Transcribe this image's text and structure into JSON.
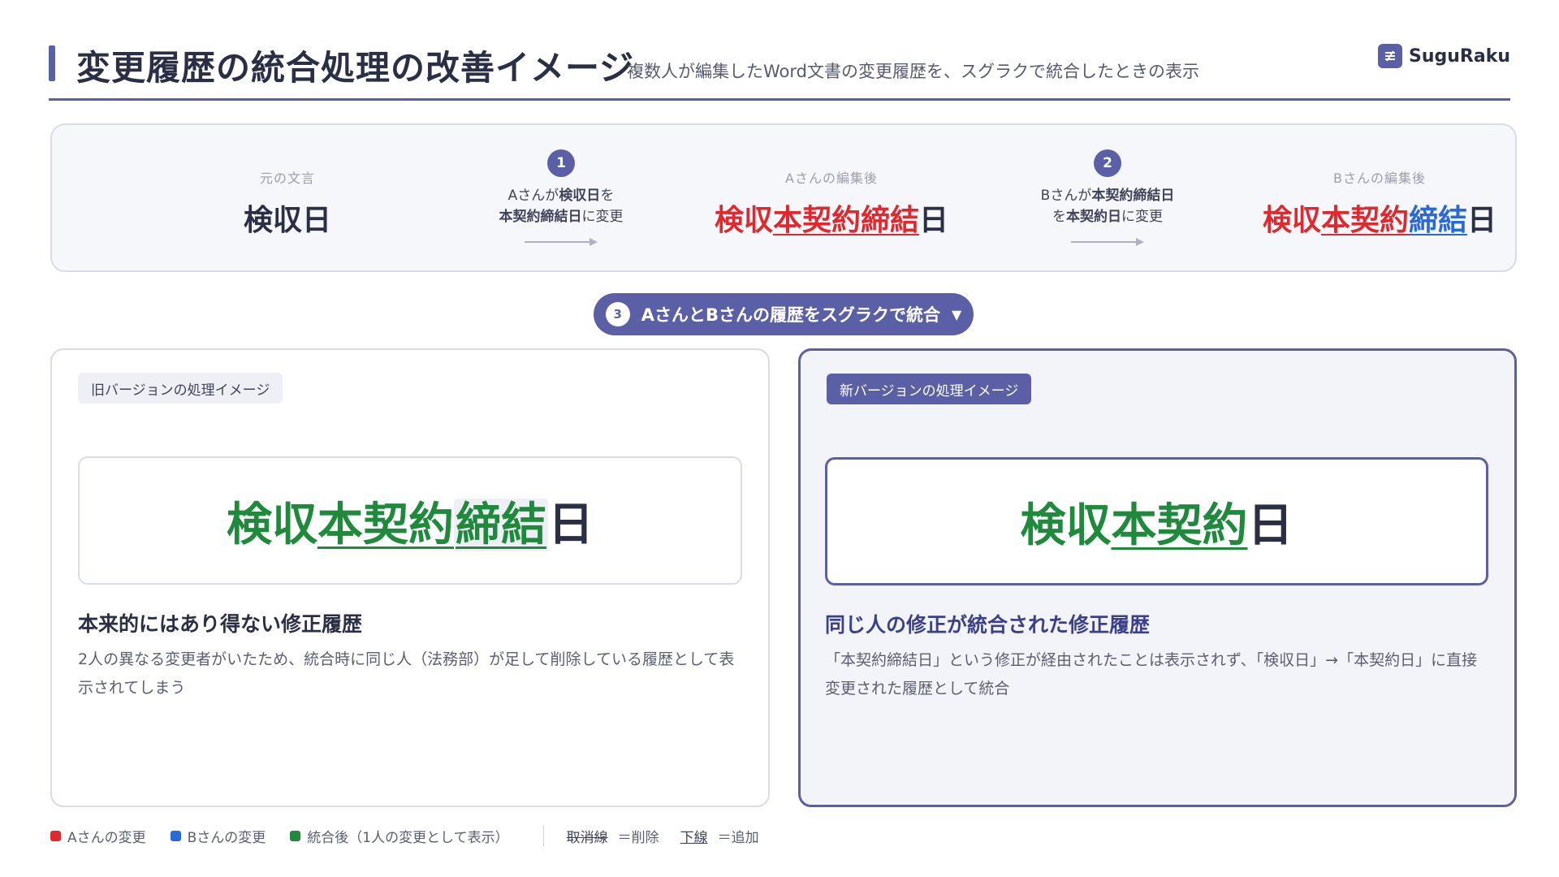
{
  "header": {
    "title": "変更履歴の統合処理の改善イメージ",
    "subtitle": "複数人が編集したWord文書の変更履歴を、スグラクで統合したときの表示",
    "brand": "SuguRaku"
  },
  "flow": {
    "original": {
      "label": "元の文言",
      "text": "検収日"
    },
    "step1": {
      "number": "1",
      "line1_prefix": "Aさんが",
      "line1_bold": "検収日",
      "line1_suffix": "を",
      "line2_bold": "本契約締結日",
      "line2_suffix": "に変更"
    },
    "after_a": {
      "label": "Aさんの編集後",
      "part1": "検収",
      "part2": "本契約締結",
      "part3": "日"
    },
    "step2": {
      "number": "2",
      "line1_prefix": "Bさんが",
      "line1_bold": "本契約締結日",
      "line2_prefix": "を",
      "line2_bold": "本契約日",
      "line2_suffix": "に変更"
    },
    "after_b": {
      "label": "Bさんの編集後",
      "part1": "検収",
      "part2": "本契約",
      "part3": "締結",
      "part4": "日"
    }
  },
  "merge": {
    "number": "3",
    "label": "AさんとBさんの履歴をスグラクで統合"
  },
  "old_version": {
    "tag": "旧バージョンの処理イメージ",
    "result": {
      "part1": "検収",
      "part2": "本契約",
      "part3": "締結",
      "part4": "日"
    },
    "heading": "本来的にはあり得ない修正履歴",
    "body": "2人の異なる変更者がいたため、統合時に同じ人（法務部）が足して削除している履歴として表示されてしまう"
  },
  "new_version": {
    "tag": "新バージョンの処理イメージ",
    "result": {
      "part1": "検収",
      "part2": "本契約",
      "part3": "日"
    },
    "heading": "同じ人の修正が統合された修正履歴",
    "body": "「本契約締結日」という修正が経由されたことは表示されず、「検収日」→「本契約日」に直接変更された履歴として統合"
  },
  "legend": {
    "a_change": "Aさんの変更",
    "b_change": "Bさんの変更",
    "merged": "統合後（1人の変更として表示）",
    "strike_sample": "取消線",
    "strike_meaning": "＝削除",
    "underline_sample": "下線",
    "underline_meaning": "＝追加"
  },
  "colors": {
    "accent": "#5b5fa6",
    "a_change": "#e0282e",
    "b_change": "#2a6ad8",
    "merged": "#1f8a3c"
  }
}
